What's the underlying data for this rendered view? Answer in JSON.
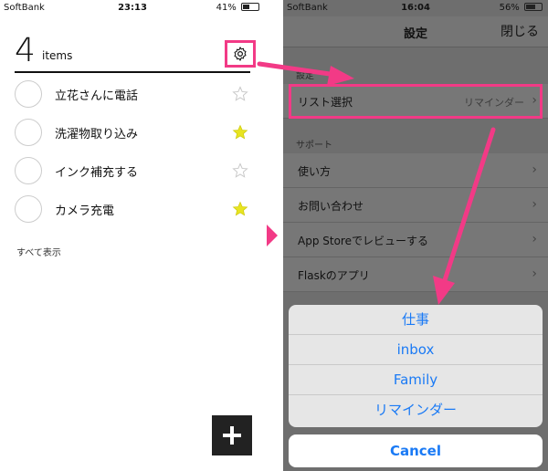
{
  "left": {
    "status": {
      "carrier": "SoftBank",
      "time": "23:13",
      "battery": "41%",
      "battery_level": 0.41
    },
    "count": "4",
    "count_unit": "items",
    "tasks": [
      {
        "label": "立花さんに電話",
        "starred": false
      },
      {
        "label": "洗濯物取り込み",
        "starred": true
      },
      {
        "label": "インク補充する",
        "starred": false
      },
      {
        "label": "カメラ充電",
        "starred": true
      }
    ],
    "show_all": "すべて表示",
    "icons": {
      "gear": "gear-icon",
      "add": "plus-icon",
      "star": "star-icon"
    }
  },
  "right": {
    "status": {
      "carrier": "SoftBank",
      "time": "16:04",
      "battery": "56%",
      "battery_level": 0.56
    },
    "nav": {
      "title": "設定",
      "close": "閉じる"
    },
    "section_settings": "設定",
    "list_select": {
      "label": "リスト選択",
      "value": "リマインダー"
    },
    "section_support": "サポート",
    "support_items": [
      "使い方",
      "お問い合わせ",
      "App Storeでレビューする",
      "Flaskのアプリ"
    ],
    "sheet_options": [
      "仕事",
      "inbox",
      "Family",
      "リマインダー"
    ],
    "cancel": "Cancel"
  },
  "colors": {
    "highlight": "#f23a86",
    "ios_blue": "#1a7af5",
    "star_yellow": "#e8e420"
  }
}
